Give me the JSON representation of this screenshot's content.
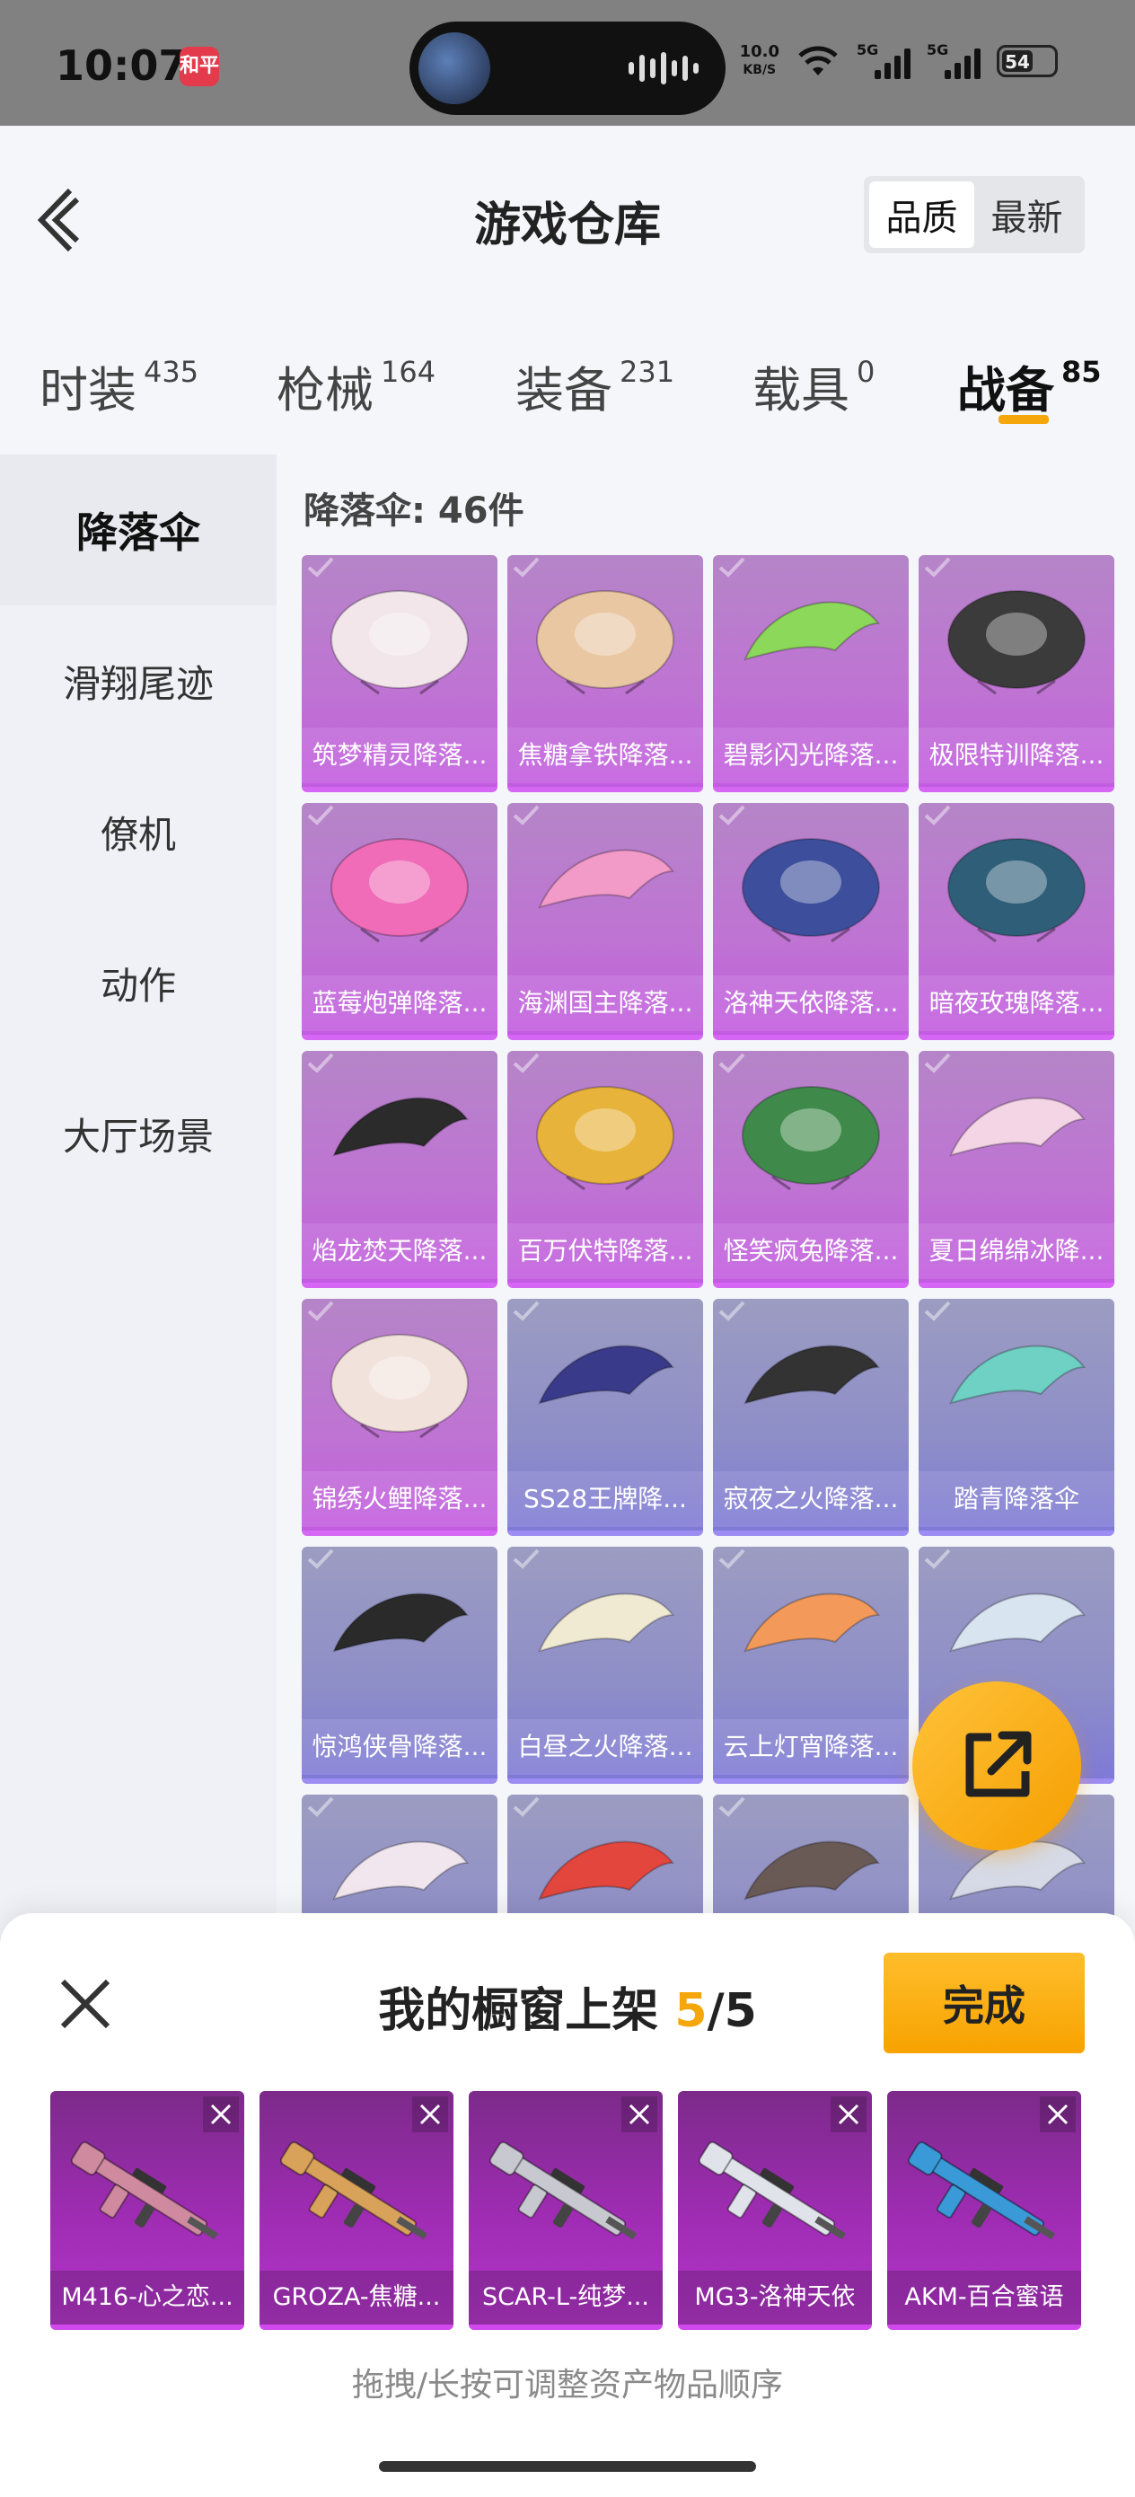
{
  "status_bar": {
    "time": "10:07",
    "app_icon": "和平",
    "net_speed": "10.0",
    "net_unit": "KB/S",
    "net1": "5G",
    "net2": "5G",
    "battery": "54"
  },
  "header": {
    "title": "游戏仓库",
    "sort": {
      "quality": "品质",
      "newest": "最新",
      "selected": "quality"
    }
  },
  "tabs": [
    {
      "label": "时装",
      "count": "435"
    },
    {
      "label": "枪械",
      "count": "164"
    },
    {
      "label": "装备",
      "count": "231"
    },
    {
      "label": "载具",
      "count": "0"
    },
    {
      "label": "战备",
      "count": "85",
      "active": true
    }
  ],
  "sidebar": {
    "items": [
      {
        "label": "降落伞",
        "active": true
      },
      {
        "label": "滑翔尾迹"
      },
      {
        "label": "僚机"
      },
      {
        "label": "动作"
      },
      {
        "label": "大厅场景"
      }
    ]
  },
  "main": {
    "count_label": "降落伞: 46件",
    "items": [
      {
        "name": "筑梦精灵降落...",
        "rarity": "purple",
        "color": "#f2e6ea"
      },
      {
        "name": "焦糖拿铁降落...",
        "rarity": "purple",
        "color": "#e9c7a3"
      },
      {
        "name": "碧影闪光降落...",
        "rarity": "purple",
        "color": "#8cd85a"
      },
      {
        "name": "极限特训降落...",
        "rarity": "purple",
        "color": "#3b3b3b"
      },
      {
        "name": "蓝莓炮弹降落...",
        "rarity": "purple",
        "color": "#f06cb8"
      },
      {
        "name": "海渊国主降落...",
        "rarity": "purple",
        "color": "#f29ac8"
      },
      {
        "name": "洛神天依降落...",
        "rarity": "purple",
        "color": "#3d4f9c"
      },
      {
        "name": "暗夜玫瑰降落...",
        "rarity": "purple",
        "color": "#2f5f78"
      },
      {
        "name": "焰龙焚天降落...",
        "rarity": "purple",
        "color": "#2b2b2b"
      },
      {
        "name": "百万伏特降落...",
        "rarity": "purple",
        "color": "#e8b33a"
      },
      {
        "name": "怪笑疯兔降落...",
        "rarity": "purple",
        "color": "#3f8a4a"
      },
      {
        "name": "夏日绵绵冰降...",
        "rarity": "purple",
        "color": "#f4d5e6"
      },
      {
        "name": "锦绣火鲤降落...",
        "rarity": "purple",
        "color": "#f2e2dc"
      },
      {
        "name": "SS28王牌降...",
        "rarity": "blue",
        "color": "#3a3a8a"
      },
      {
        "name": "寂夜之火降落...",
        "rarity": "blue",
        "color": "#333333"
      },
      {
        "name": "踏青降落伞",
        "rarity": "blue",
        "color": "#6fd1c3"
      },
      {
        "name": "惊鸿侠骨降落...",
        "rarity": "blue",
        "color": "#2a2a2a"
      },
      {
        "name": "白昼之火降落...",
        "rarity": "blue",
        "color": "#f0ead2"
      },
      {
        "name": "云上灯宵降落...",
        "rarity": "blue",
        "color": "#f39a5a"
      },
      {
        "name": "",
        "rarity": "blue",
        "color": "#d8e4f0"
      },
      {
        "name": "",
        "rarity": "blue",
        "color": "#f1e6ee"
      },
      {
        "name": "",
        "rarity": "blue",
        "color": "#e2463d"
      },
      {
        "name": "",
        "rarity": "blue",
        "color": "#6a5a55"
      },
      {
        "name": "",
        "rarity": "blue",
        "color": "#d6dae6"
      }
    ]
  },
  "bottom_sheet": {
    "title": "我的橱窗上架",
    "current": "5",
    "separator": "/",
    "max": "5",
    "done_label": "完成",
    "hint": "拖拽/长按可调整资产物品顺序",
    "slots": [
      {
        "name": "M416-心之恋...",
        "color": "#d08aa0"
      },
      {
        "name": "GROZA-焦糖...",
        "color": "#d8a25a"
      },
      {
        "name": "SCAR-L-纯梦...",
        "color": "#c8c8d0"
      },
      {
        "name": "MG3-洛神天依",
        "color": "#e0e4ea"
      },
      {
        "name": "AKM-百合蜜语",
        "color": "#3a9ad8"
      }
    ]
  },
  "colors": {
    "accent": "#f5a60a",
    "purple_rarity": "#c25be0",
    "blue_rarity": "#8e8ec8"
  }
}
